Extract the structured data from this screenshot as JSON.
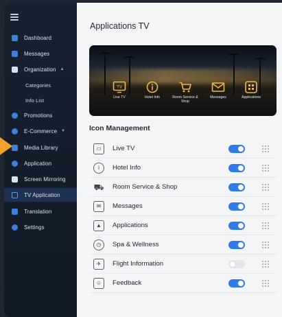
{
  "sidebar": {
    "items": [
      {
        "label": "Dashboard",
        "icon": "dashboard-icon"
      },
      {
        "label": "Messages",
        "icon": "messages-icon"
      },
      {
        "label": "Organization",
        "icon": "organization-icon",
        "expanded": true
      },
      {
        "label": "Categories",
        "sub": true
      },
      {
        "label": "Info List",
        "sub": true
      },
      {
        "label": "Promotions",
        "icon": "promotions-icon"
      },
      {
        "label": "E-Commerce",
        "icon": "ecommerce-icon"
      },
      {
        "label": "Media Library",
        "icon": "media-library-icon"
      },
      {
        "label": "Application",
        "icon": "application-icon"
      },
      {
        "label": "Screen Mirroring",
        "icon": "screen-mirroring-icon"
      },
      {
        "label": "TV Application",
        "icon": "tv-application-icon",
        "active": true
      },
      {
        "label": "Translation",
        "icon": "translation-icon"
      },
      {
        "label": "Settings",
        "icon": "settings-icon"
      }
    ]
  },
  "main": {
    "title": "Applications TV",
    "preview": {
      "tiles": [
        {
          "label": "Live TV",
          "icon": "tv-icon"
        },
        {
          "label": "Hotel Info",
          "icon": "info-icon"
        },
        {
          "label": "Room Service & Shop",
          "icon": "cart-icon"
        },
        {
          "label": "Messages",
          "icon": "envelope-icon"
        },
        {
          "label": "Applications",
          "icon": "apps-grid-icon"
        }
      ]
    },
    "icon_management": {
      "title": "Icon Management",
      "rows": [
        {
          "label": "Live TV",
          "icon": "tv-icon",
          "enabled": true
        },
        {
          "label": "Hotel Info",
          "icon": "info-icon",
          "enabled": true
        },
        {
          "label": "Room Service & Shop",
          "icon": "cart-icon",
          "enabled": true
        },
        {
          "label": "Messages",
          "icon": "envelope-icon",
          "enabled": true
        },
        {
          "label": "Applications",
          "icon": "apps-icon",
          "enabled": true
        },
        {
          "label": "Spa & Wellness",
          "icon": "spa-clock-icon",
          "enabled": true
        },
        {
          "label": "Flight Information",
          "icon": "flight-icon",
          "enabled": false
        },
        {
          "label": "Feedback",
          "icon": "feedback-icon",
          "enabled": true
        }
      ]
    }
  },
  "colors": {
    "accent": "#2f7ce8",
    "sidebar_bg": "#141e2b",
    "tile_icon": "#f2b84a",
    "pointer": "#f0a22a"
  }
}
